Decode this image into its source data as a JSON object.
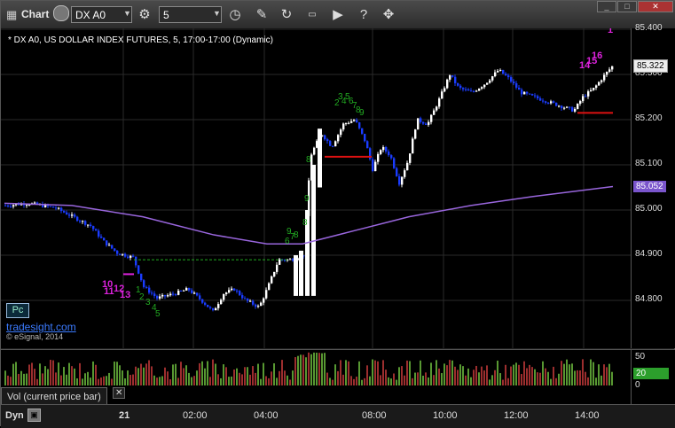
{
  "toolbar": {
    "app_label": "Chart",
    "symbol": "DX A0",
    "interval": "5"
  },
  "chart": {
    "title": "* DX A0, US DOLLAR INDEX FUTURES, 5, 17:00-17:00 (Dynamic)",
    "watermark_site": "tradesight.com",
    "watermark_copyright": "© eSignal, 2014",
    "pc_badge": "Pc",
    "price_axis": [
      "85.400",
      "85.300",
      "85.200",
      "85.100",
      "85.000",
      "84.900",
      "84.800"
    ],
    "last_price": "85.322",
    "ma_value": "85.052",
    "colors": {
      "up": "#ffffff",
      "down": "#1a3cff",
      "ma": "#9966dd",
      "setup_green": "#22aa22",
      "countdown_magenta": "#dd22dd",
      "level": "#dd1111"
    },
    "annotations_green": [
      "8",
      "8",
      "9",
      "1",
      "2",
      "3",
      "4",
      "5",
      "6",
      "7",
      "8",
      "9",
      "2",
      "3",
      "4",
      "5",
      "6",
      "7",
      "8",
      "9"
    ],
    "annotations_magenta": [
      "10",
      "11",
      "12",
      "13",
      "14",
      "15",
      "16",
      "1"
    ],
    "chart_type": "candlestick"
  },
  "volume": {
    "label": "Vol (current price bar)",
    "close_label": "✕",
    "axis": [
      "50",
      "20",
      "0"
    ]
  },
  "xaxis": {
    "mode": "Dyn",
    "labels": [
      "21",
      "02:00",
      "04:00",
      "08:00",
      "10:00",
      "12:00",
      "14:00"
    ]
  }
}
